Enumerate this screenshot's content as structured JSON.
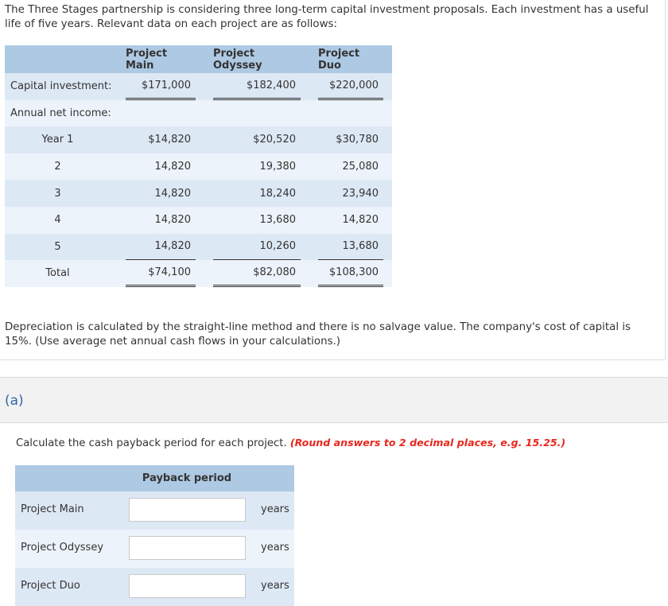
{
  "intro": "The Three Stages partnership is considering three long-term capital investment proposals. Each investment has a useful life of five years. Relevant data on each project are as follows:",
  "table": {
    "headers": [
      "Project Main",
      "Project Odyssey",
      "Project Duo"
    ],
    "capital_label": "Capital investment:",
    "capital": [
      "$171,000",
      "$182,400",
      "$220,000"
    ],
    "annual_label": "Annual net income:",
    "years": [
      {
        "label": "Year 1",
        "values": [
          "$14,820",
          "$20,520",
          "$30,780"
        ]
      },
      {
        "label": "2",
        "values": [
          "14,820",
          "19,380",
          "25,080"
        ]
      },
      {
        "label": "3",
        "values": [
          "14,820",
          "18,240",
          "23,940"
        ]
      },
      {
        "label": "4",
        "values": [
          "14,820",
          "13,680",
          "14,820"
        ]
      },
      {
        "label": "5",
        "values": [
          "14,820",
          "10,260",
          "13,680"
        ]
      }
    ],
    "total_label": "Total",
    "totals": [
      "$74,100",
      "$82,080",
      "$108,300"
    ]
  },
  "note": "Depreciation is calculated by the straight-line method and there is no salvage value. The company's cost of capital is 15%. (Use average net annual cash flows in your calculations.)",
  "section": {
    "label": "(a)"
  },
  "instruction": {
    "text": "Calculate the cash payback period for each project.",
    "emphasis": "(Round answers to 2 decimal places, e.g. 15.25.)"
  },
  "answer": {
    "header": "Payback period",
    "rows": [
      {
        "label": "Project Main",
        "value": "",
        "unit": "years"
      },
      {
        "label": "Project Odyssey",
        "value": "",
        "unit": "years"
      },
      {
        "label": "Project Duo",
        "value": "",
        "unit": "years"
      }
    ]
  }
}
